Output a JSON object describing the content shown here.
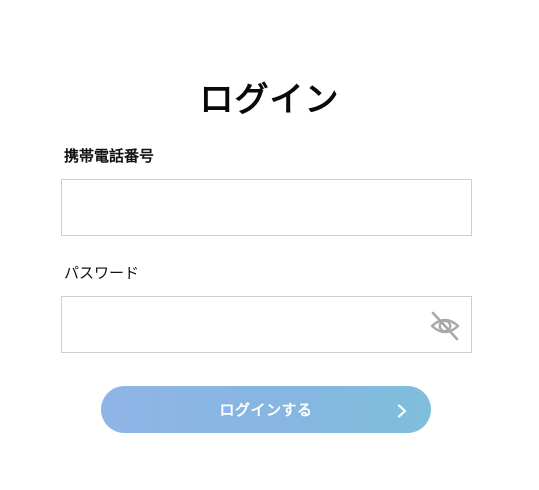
{
  "page": {
    "title": "ログイン"
  },
  "form": {
    "phone": {
      "label": "携帯電話番号",
      "value": "",
      "placeholder": ""
    },
    "password": {
      "label": "パスワード",
      "value": "",
      "placeholder": "",
      "toggle_icon": "eye-slash-icon"
    },
    "submit": {
      "label": "ログインする",
      "icon": "chevron-right-icon"
    }
  },
  "colors": {
    "button_gradient_start": "#8fb5e6",
    "button_gradient_end": "#7fbedb",
    "field_border": "#cfcfcf",
    "icon_gray": "#a8a8a8"
  }
}
